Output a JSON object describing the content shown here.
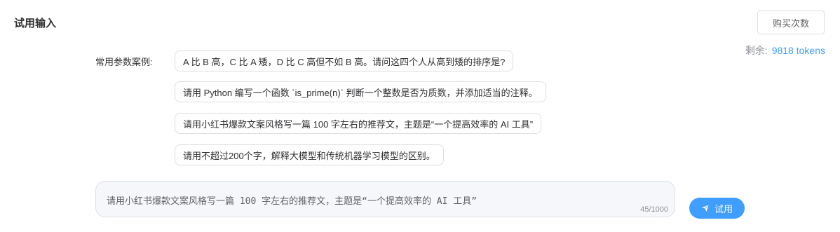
{
  "section_title": "试用输入",
  "buy_button": "购买次数",
  "remaining": {
    "label": "剩余:",
    "value": "9818 tokens"
  },
  "examples": {
    "label": "常用参数案例:",
    "items": [
      "A 比 B 高，C 比 A 矮，D 比 C 高但不如 B 高。请问这四个人从高到矮的排序是?",
      "请用 Python 编写一个函数 `is_prime(n)` 判断一个整数是否为质数，并添加适当的注释。",
      "请用小红书爆款文案风格写一篇 100 字左右的推荐文，主题是“一个提高效率的 AI 工具”",
      "请用不超过200个字，解释大模型和传统机器学习模型的区别。"
    ]
  },
  "input": {
    "value": "请用小红书爆款文案风格写一篇 100 字左右的推荐文，主题是“一个提高效率的 AI 工具”",
    "counter": "45/1000"
  },
  "try_button": {
    "label": "试用",
    "icon": "send-icon"
  },
  "colors": {
    "accent": "#409eff",
    "muted": "#909399",
    "border": "#dcdfe6"
  }
}
